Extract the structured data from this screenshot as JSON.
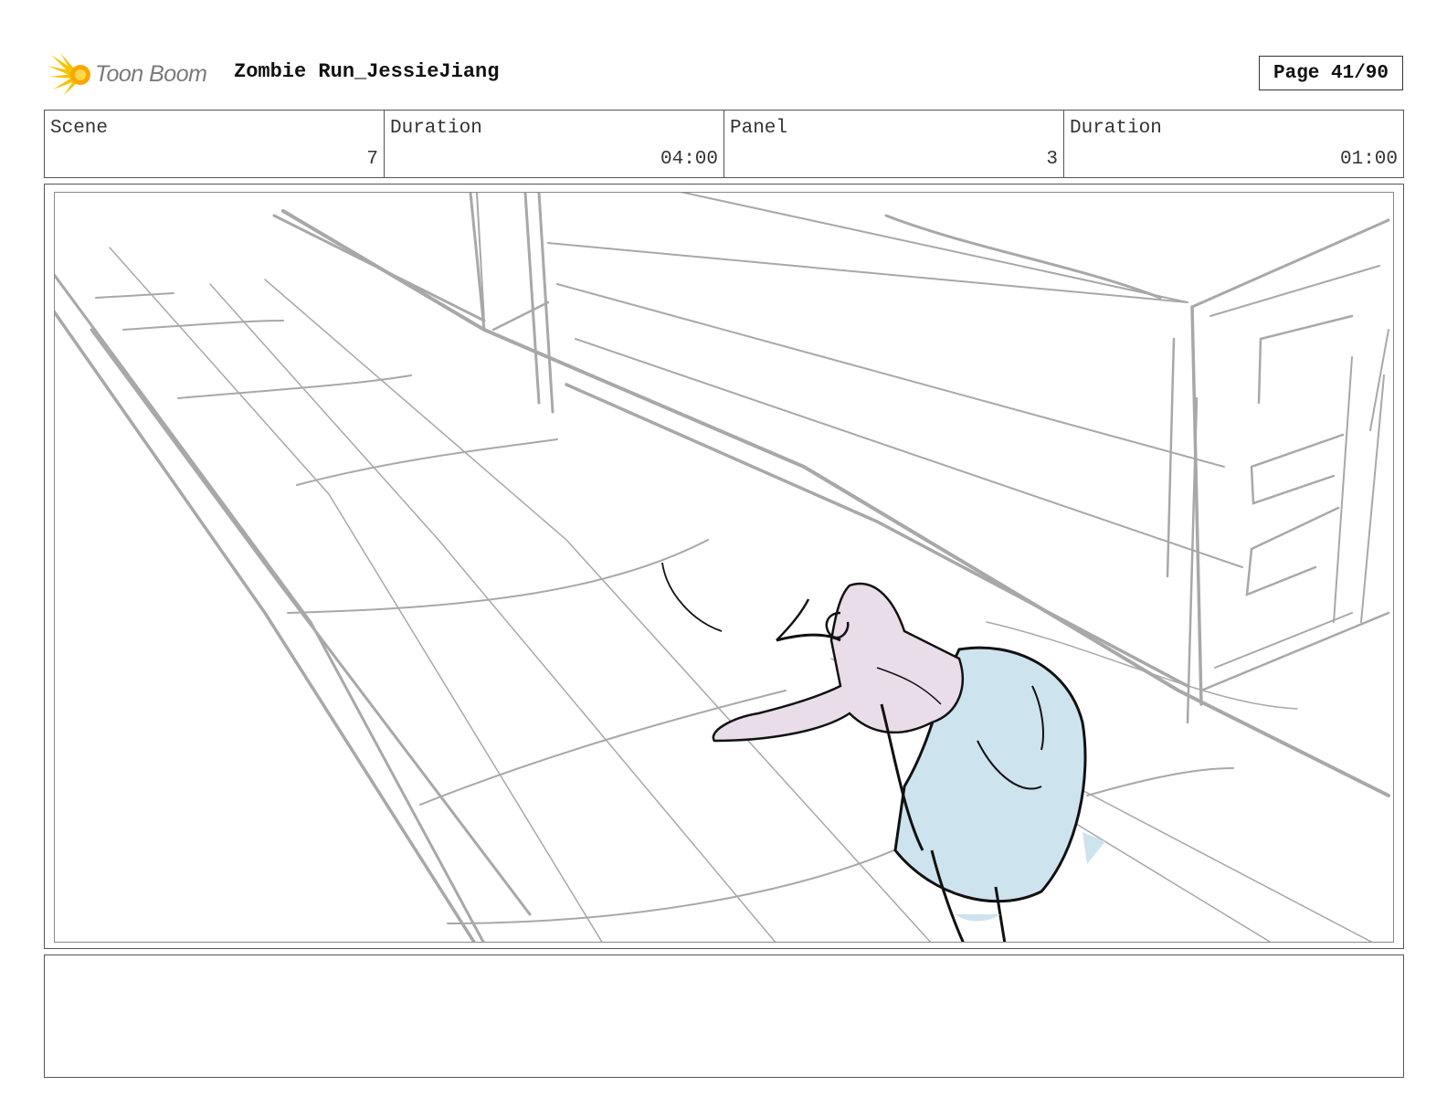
{
  "header": {
    "logo_text": "Toon Boom",
    "project_title": "Zombie Run_JessieJiang",
    "page_label": "Page 41/90"
  },
  "info": {
    "scene_label": "Scene",
    "scene_value": "7",
    "scene_duration_label": "Duration",
    "scene_duration_value": "04:00",
    "panel_label": "Panel",
    "panel_value": "3",
    "panel_duration_label": "Duration",
    "panel_duration_value": "01:00"
  },
  "panel": {
    "sketch": "rough storyboard sketch"
  },
  "colors": {
    "sketch_line": "#a8a8a8",
    "ink_line": "#111111",
    "character_blue": "#cde3ee",
    "character_pink": "#e8dde8",
    "logo_yellow": "#f5c400"
  },
  "notes": {
    "text": ""
  }
}
